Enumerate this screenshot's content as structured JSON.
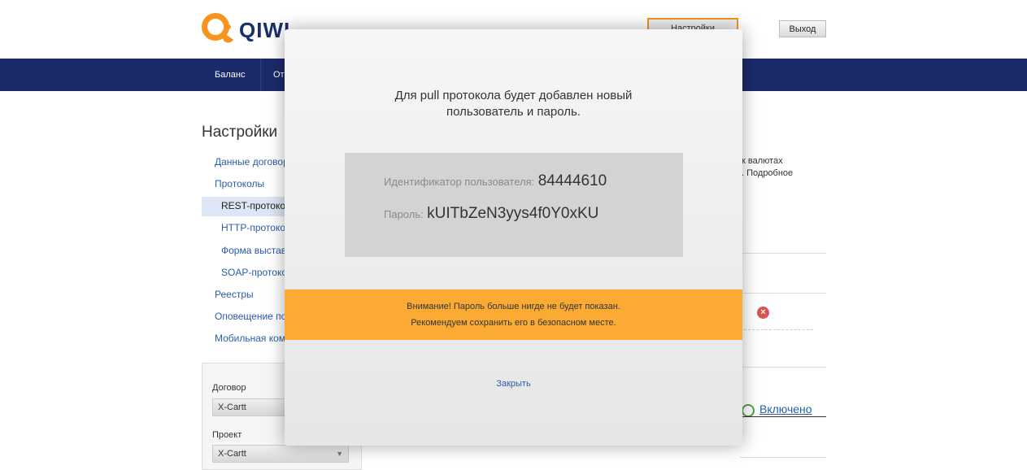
{
  "header": {
    "logo_text": "QIWI",
    "settings_label": "Настройки",
    "exit_label": "Выход"
  },
  "nav": {
    "items": [
      "Баланс",
      "От"
    ]
  },
  "sidebar": {
    "title": "Настройки",
    "items": [
      {
        "label": "Данные договор"
      },
      {
        "label": "Протоколы"
      },
      {
        "label": "REST-протоко"
      },
      {
        "label": "HTTP-протоко"
      },
      {
        "label": "Форма выстав"
      },
      {
        "label": "SOAP-протоко"
      },
      {
        "label": "Реестры"
      },
      {
        "label": "Оповещение по"
      },
      {
        "label": "Мобильная ком"
      }
    ],
    "filter": {
      "contract_label": "Договор",
      "contract_value": "X-Cartt",
      "project_label": "Проект",
      "project_value": "X-Cartt"
    }
  },
  "background": {
    "text_line1": "к валютах",
    "text_line2": ". Подробное",
    "enabled_label": "Включено"
  },
  "modal": {
    "message_line1": "Для pull протокола будет добавлен новый",
    "message_line2": "пользователь и пароль.",
    "user_id_label": "Идентификатор пользователя:",
    "user_id_value": "84444610",
    "password_label": "Пароль:",
    "password_value": "kUITbZeN3yys4f0Y0xKU",
    "warning_line1": "Внимание! Пароль больше нигде не будет показан.",
    "warning_line2": "Рекомендуем сохранить его в безопасном месте.",
    "close_label": "Закрыть"
  },
  "colors": {
    "accent_orange": "#fbab33",
    "nav_blue": "#1b2a6b",
    "link_blue": "#2a5ca8"
  }
}
